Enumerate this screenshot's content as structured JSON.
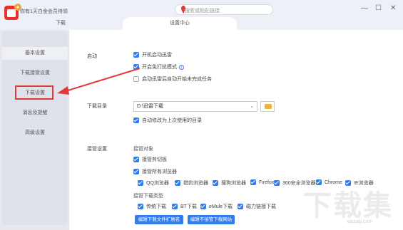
{
  "header": {
    "promo": "你有1天白金会员待领",
    "search_placeholder": "搜索或粘贴链接",
    "win_min": "—",
    "win_max": "☐",
    "win_close": "✕"
  },
  "tabs": [
    {
      "label": "下载"
    },
    {
      "label": "设置中心"
    }
  ],
  "sidebar": {
    "items": [
      {
        "label": "基本设置"
      },
      {
        "label": "下载接管设置"
      },
      {
        "label": "下载设置"
      },
      {
        "label": "消息及提醒"
      },
      {
        "label": "高级设置"
      }
    ]
  },
  "startup": {
    "label": "启动",
    "options": [
      {
        "label": "开机启动迅雷",
        "checked": true
      },
      {
        "label": "开启免打扰模式",
        "checked": true
      },
      {
        "label": "启动迅雷后自动开始未完成任务",
        "checked": false
      }
    ]
  },
  "download_dir": {
    "label": "下载目录",
    "path": "D:\\迅雷下载",
    "caret": "⌄",
    "remember": "自动修改为上次使用的目录"
  },
  "takeover": {
    "label": "接管设置",
    "target_label": "接管对象",
    "clipboard": "接管剪切板",
    "all_browsers": "接管所有浏览器",
    "browsers": [
      "QQ浏览器",
      "猎豹浏览器",
      "搜狗浏览器",
      "Firefox",
      "360安全浏览器",
      "Chrome",
      "IE浏览器"
    ],
    "type_label": "接管下载类型",
    "types": [
      "传统下载",
      "BT下载",
      "eMule下载",
      "磁力链接下载"
    ],
    "btn_ext": "编辑下载文件扩展名",
    "btn_sites": "编辑不接管下载网站"
  },
  "watermark": "下载集",
  "watermark_url": "xiazaiji.com",
  "colors": {
    "accent": "#2f7cf0",
    "highlight": "#e03a3a",
    "logo": "#e8322f"
  }
}
